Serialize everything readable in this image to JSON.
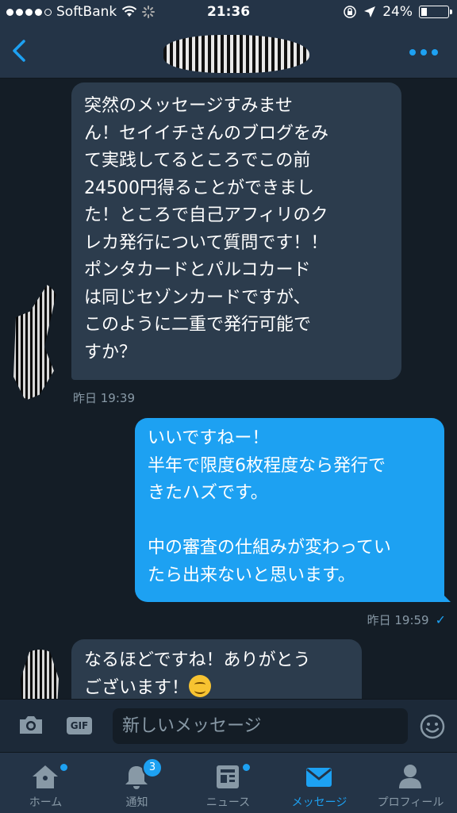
{
  "status_bar": {
    "carrier": "SoftBank",
    "time": "21:36",
    "battery": "24%",
    "battery_level": 0.24
  },
  "conversation": {
    "messages": [
      {
        "direction": "incoming",
        "text": "突然のメッセージすみませ\nん！セイイチさんのブログをみ\nて実践してるところでこの前\n24500円得ることができまし\nた！ところで自己アフィリのク\nレカ発行について質問です！！\nポンタカードとパルコカード\nは同じセゾンカードですが、\nこのように二重で発行可能で\nすか？",
        "timestamp": "昨日 19:39"
      },
      {
        "direction": "outgoing",
        "text": "いいですねー！\n半年で限度6枚程度なら発行で\nきたハズです。\n\n中の審査の仕組みが変わってい\nたら出来ないと思います。",
        "timestamp": "昨日 19:59",
        "status_icon": "check-icon"
      },
      {
        "direction": "incoming",
        "text_line1": "なるほどですね！ありがとう",
        "text_line2": "ございます！",
        "emoji": "smiling-face-emoji"
      }
    ]
  },
  "composer": {
    "placeholder": "新しいメッセージ",
    "gif_label": "GIF"
  },
  "tab_bar": {
    "tabs": [
      {
        "label": "ホーム",
        "icon": "home-icon",
        "badge": "dot"
      },
      {
        "label": "通知",
        "icon": "bell-icon",
        "badge": "3"
      },
      {
        "label": "ニュース",
        "icon": "news-icon",
        "badge": "dot"
      },
      {
        "label": "メッセージ",
        "icon": "envelope-icon",
        "active": true
      },
      {
        "label": "プロフィール",
        "icon": "profile-icon"
      }
    ]
  },
  "colors": {
    "background": "#141d26",
    "bar": "#243447",
    "accent": "#1da1f2",
    "incoming_bubble": "#2c3c4d",
    "muted": "#8899a6"
  }
}
